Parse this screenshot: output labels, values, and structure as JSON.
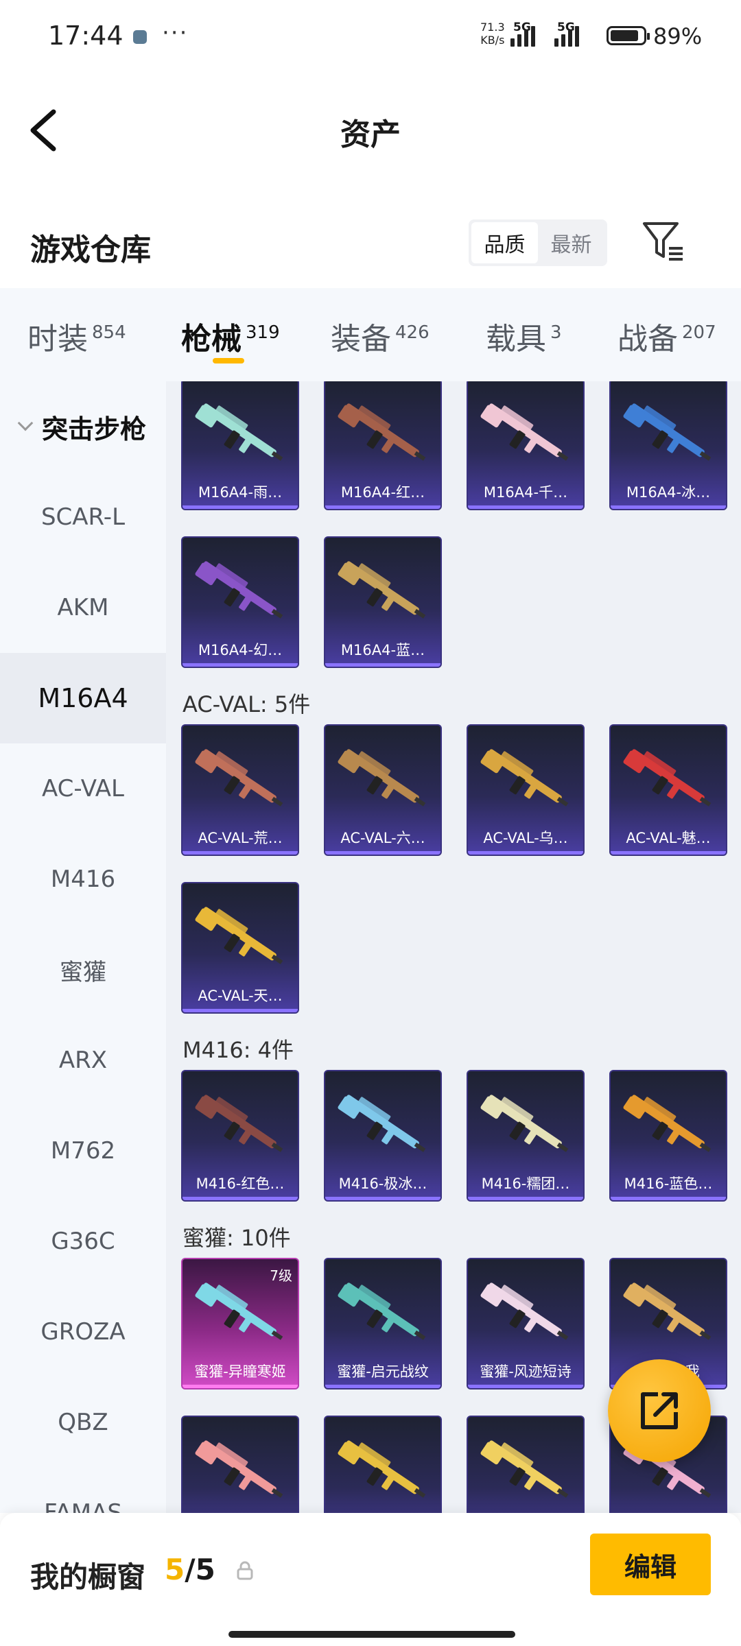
{
  "status_bar": {
    "time": "17:44",
    "speed_value": "71.3",
    "speed_unit": "KB/s",
    "network1": "5G",
    "network2": "5G",
    "battery": "89%"
  },
  "header": {
    "title": "资产"
  },
  "warehouse": {
    "title": "游戏仓库",
    "sort_options": [
      "品质",
      "最新"
    ],
    "selected_sort": "品质"
  },
  "tabs": [
    {
      "label": "时装",
      "count": "854"
    },
    {
      "label": "枪械",
      "count": "319"
    },
    {
      "label": "装备",
      "count": "426"
    },
    {
      "label": "载具",
      "count": "3"
    },
    {
      "label": "战备",
      "count": "207"
    }
  ],
  "active_tab": "枪械",
  "sidebar": {
    "group": "突击步枪",
    "items": [
      "SCAR-L",
      "AKM",
      "M16A4",
      "AC-VAL",
      "M416",
      "蜜獾",
      "ARX",
      "M762",
      "G36C",
      "GROZA",
      "QBZ",
      "FAMAS"
    ],
    "active": "M16A4"
  },
  "sections": [
    {
      "title": "",
      "items": [
        {
          "label": "M16A4-雨…",
          "color": "#9fe0d4",
          "rarity": "purple"
        },
        {
          "label": "M16A4-红…",
          "color": "#a5604a",
          "rarity": "purple"
        },
        {
          "label": "M16A4-千…",
          "color": "#f0c6d4",
          "rarity": "purple"
        },
        {
          "label": "M16A4-冰…",
          "color": "#3f7fd6",
          "rarity": "purple"
        },
        {
          "label": "M16A4-幻…",
          "color": "#8a55c8",
          "rarity": "purple"
        },
        {
          "label": "M16A4-蓝…",
          "color": "#c8a35a",
          "rarity": "purple"
        }
      ]
    },
    {
      "title": "AC-VAL: 5件",
      "items": [
        {
          "label": "AC-VAL-荒…",
          "color": "#c0705a",
          "rarity": "purple"
        },
        {
          "label": "AC-VAL-六…",
          "color": "#b8894e",
          "rarity": "purple"
        },
        {
          "label": "AC-VAL-乌…",
          "color": "#d9a640",
          "rarity": "purple"
        },
        {
          "label": "AC-VAL-魅…",
          "color": "#d83a3a",
          "rarity": "purple"
        },
        {
          "label": "AC-VAL-天…",
          "color": "#e8b838",
          "rarity": "purple"
        }
      ]
    },
    {
      "title": "M416: 4件",
      "items": [
        {
          "label": "M416-红色…",
          "color": "#8a4a44",
          "rarity": "purple"
        },
        {
          "label": "M416-极冰…",
          "color": "#7fc8ea",
          "rarity": "purple"
        },
        {
          "label": "M416-糯团…",
          "color": "#e6e2b8",
          "rarity": "purple"
        },
        {
          "label": "M416-蓝色…",
          "color": "#e59a2e",
          "rarity": "purple"
        }
      ]
    },
    {
      "title": "蜜獾: 10件",
      "items": [
        {
          "label": "蜜獾-异瞳寒姬",
          "color": "#7fd8e6",
          "rarity": "pink",
          "level": "7级"
        },
        {
          "label": "蜜獾-启元战纹",
          "color": "#5cc0b8",
          "rarity": "purple"
        },
        {
          "label": "蜜獾-风迹短诗",
          "color": "#f0d8e8",
          "rarity": "purple"
        },
        {
          "label": "蜜獾-…我",
          "color": "#e0b060",
          "rarity": "purple"
        },
        {
          "label": "",
          "color": "#f09a9a",
          "rarity": "purple"
        },
        {
          "label": "",
          "color": "#e8c040",
          "rarity": "purple"
        },
        {
          "label": "",
          "color": "#f0d060",
          "rarity": "purple"
        },
        {
          "label": "",
          "color": "#f0b0d0",
          "rarity": "purple"
        }
      ]
    }
  ],
  "showcase": {
    "label": "我的橱窗",
    "current": "5",
    "separator": "/",
    "total": "5"
  },
  "edit_button": {
    "label": "编辑"
  },
  "colors": {
    "accent": "#ffbb00",
    "card_purple": "#4a3ea3",
    "card_pink": "#d24cc7"
  },
  "icons": [
    "back-arrow-icon",
    "filter-icon",
    "share-export-icon",
    "lock-icon",
    "chevron-down-icon"
  ]
}
